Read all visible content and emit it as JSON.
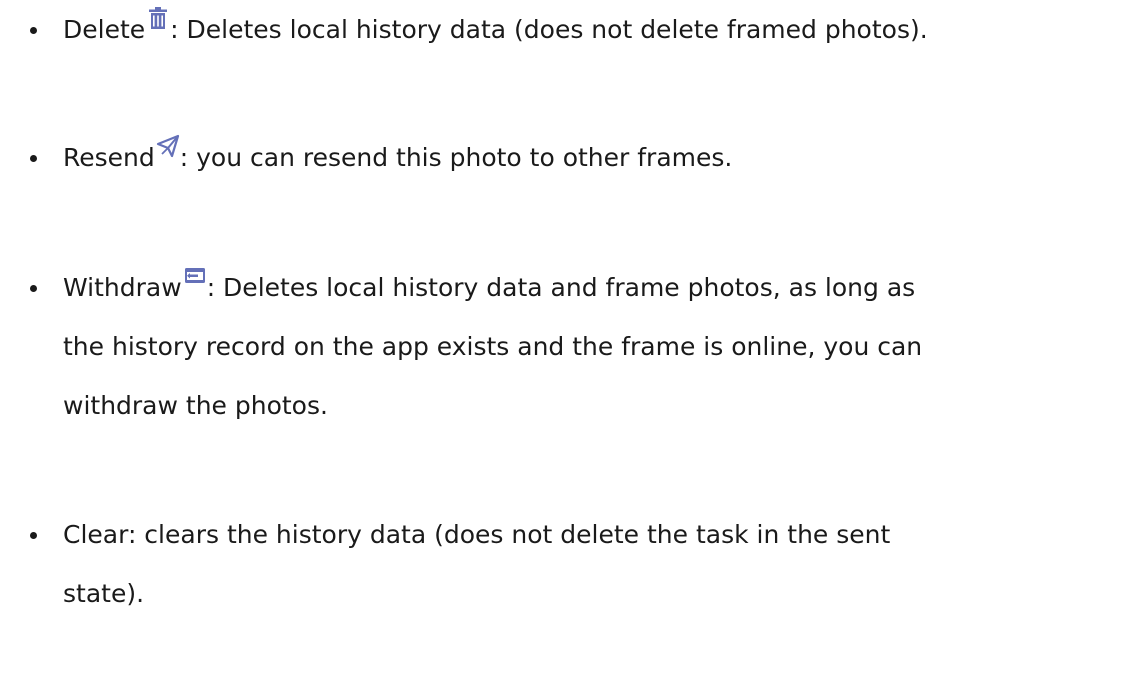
{
  "items": [
    {
      "term": "Delete",
      "icon": "trash-icon",
      "lines": [
        ": Deletes local history data (does not delete framed photos)."
      ]
    },
    {
      "term": "Resend",
      "icon": "paper-plane-icon",
      "lines": [
        ": you can resend this photo to other frames."
      ]
    },
    {
      "term": "Withdraw",
      "icon": "withdraw-icon",
      "lines": [
        ": Deletes local history data and frame photos, as long as",
        "the history record on the app exists and the frame is online, you can",
        "withdraw the photos."
      ]
    },
    {
      "term": "Clear",
      "lines": [
        "Clear: clears the history data (does not delete the task in the sent",
        "state)."
      ]
    }
  ],
  "colors": {
    "text": "#1a1a1a",
    "icon": "#6470b8"
  }
}
